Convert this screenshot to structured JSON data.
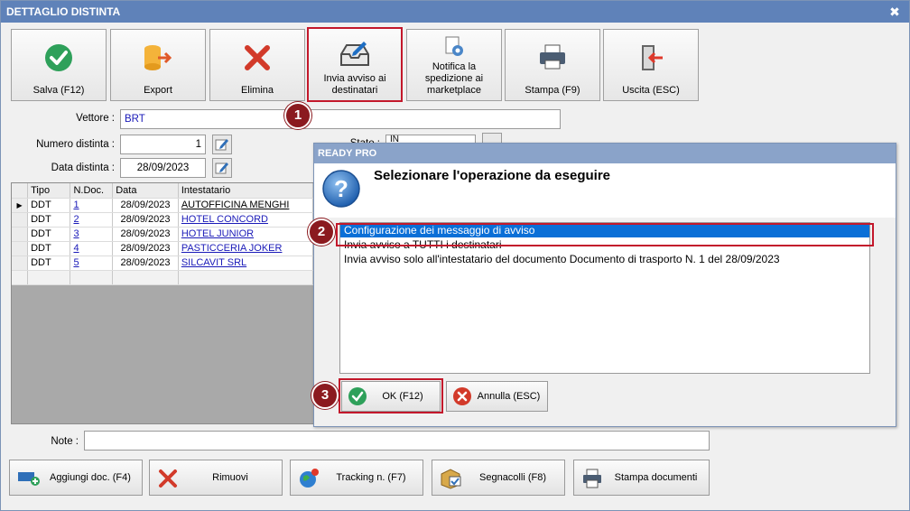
{
  "window": {
    "title": "DETTAGLIO DISTINTA",
    "close_glyph": "✖"
  },
  "toolbar": {
    "save": "Salva (F12)",
    "export": "Export",
    "delete": "Elimina",
    "notify": "Invia avviso ai destinatari",
    "marketplace": "Notifica la spedizione ai marketplace",
    "print": "Stampa (F9)",
    "exit": "Uscita (ESC)"
  },
  "form": {
    "carrier_label": "Vettore :",
    "carrier_value": "BRT",
    "number_label": "Numero distinta :",
    "number_value": "1",
    "date_label": "Data distinta :",
    "date_value": "28/09/2023",
    "state_label": "Stato :",
    "state_value": "IN PREPARAZIONE",
    "note_label": "Note :",
    "note_value": ""
  },
  "grid": {
    "headers": [
      "Tipo",
      "N.Doc.",
      "Data",
      "Intestatario"
    ],
    "rows": [
      {
        "tipo": "DDT",
        "ndoc": "1",
        "data": "28/09/2023",
        "intestatario": "AUTOFFICINA MENGHI"
      },
      {
        "tipo": "DDT",
        "ndoc": "2",
        "data": "28/09/2023",
        "intestatario": "HOTEL CONCORD"
      },
      {
        "tipo": "DDT",
        "ndoc": "3",
        "data": "28/09/2023",
        "intestatario": "HOTEL JUNIOR"
      },
      {
        "tipo": "DDT",
        "ndoc": "4",
        "data": "28/09/2023",
        "intestatario": "PASTICCERIA JOKER"
      },
      {
        "tipo": "DDT",
        "ndoc": "5",
        "data": "28/09/2023",
        "intestatario": "SILCAVIT SRL"
      }
    ],
    "current_row_glyph": "▶"
  },
  "dialog": {
    "title": "READY PRO",
    "heading": "Selezionare l'operazione da eseguire",
    "options": [
      "Configurazione dei messaggio di avviso",
      "Invia avviso a TUTTI i destinatari",
      "Invia avviso solo all'intestatario del documento Documento di trasporto N. 1 del 28/09/2023"
    ],
    "ok": "OK (F12)",
    "cancel": "Annulla (ESC)"
  },
  "bottom": {
    "add_doc": "Aggiungi doc. (F4)",
    "remove": "Rimuovi",
    "tracking": "Tracking n. (F7)",
    "labels": "Segnacolli (F8)",
    "print_docs": "Stampa documenti"
  },
  "badges": [
    "1",
    "2",
    "3"
  ],
  "colors": {
    "titlebar": "#5f82b9",
    "highlight": "#c3182b",
    "selection": "#0a6fd7",
    "badge": "#8b1a1f"
  }
}
